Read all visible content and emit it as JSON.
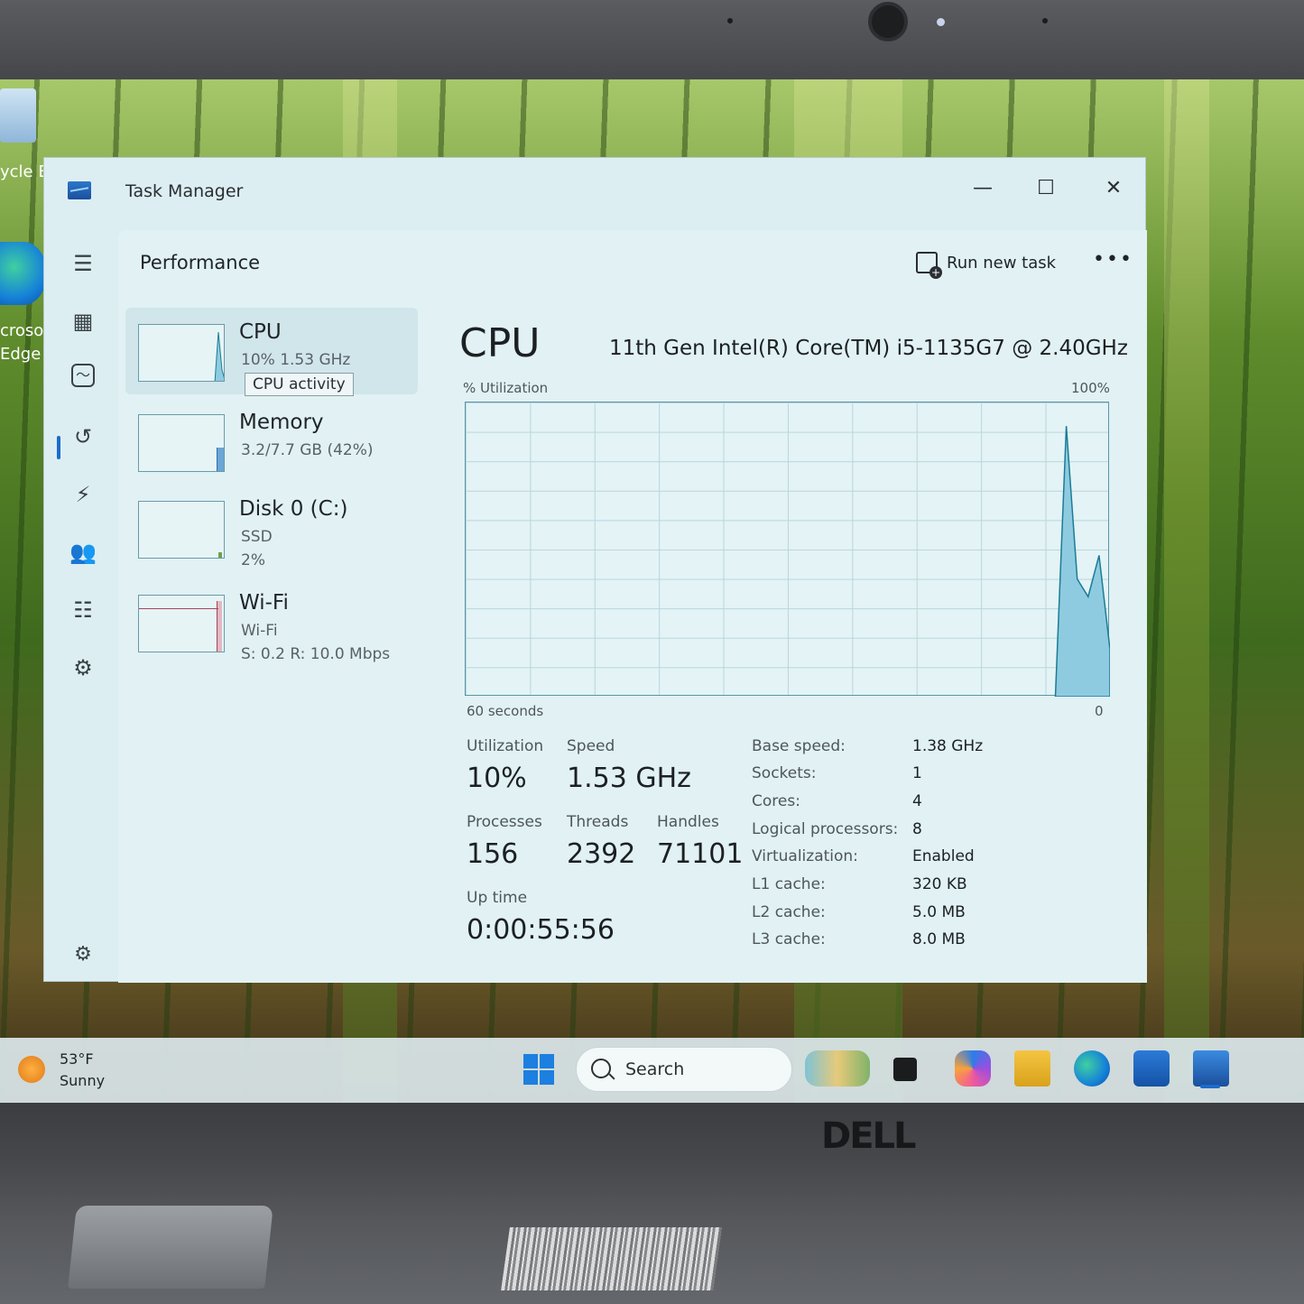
{
  "device": {
    "brand": "DELL"
  },
  "desktop": {
    "icons": [
      {
        "label_line1": "ycle B",
        "label_line2": ""
      },
      {
        "label_line1": "crosof",
        "label_line2": "Edge"
      }
    ]
  },
  "window": {
    "title": "Task Manager",
    "minimize": "—",
    "maximize": "☐",
    "close": "✕"
  },
  "header": {
    "page_title": "Performance",
    "run_new_task": "Run new task",
    "more": "•••"
  },
  "nav": {
    "icons": [
      "hamburger-icon",
      "processes-icon",
      "performance-icon",
      "app-history-icon",
      "startup-apps-icon",
      "users-icon",
      "details-icon",
      "services-icon",
      "settings-icon"
    ]
  },
  "resources": [
    {
      "name": "CPU",
      "sub1": "10%  1.53 GHz",
      "sub2": "",
      "tooltip": "CPU activity"
    },
    {
      "name": "Memory",
      "sub1": "3.2/7.7 GB (42%)",
      "sub2": ""
    },
    {
      "name": "Disk 0 (C:)",
      "sub1": "SSD",
      "sub2": "2%"
    },
    {
      "name": "Wi-Fi",
      "sub1": "Wi-Fi",
      "sub2": "S: 0.2  R: 10.0 Mbps"
    }
  ],
  "cpu": {
    "heading": "CPU",
    "model": "11th Gen Intel(R) Core(TM) i5-1135G7 @ 2.40GHz",
    "graph_ylabel": "% Utilization",
    "graph_ymax": "100%",
    "graph_xlabel": "60 seconds",
    "graph_xmin": "0",
    "stats": {
      "utilization_label": "Utilization",
      "utilization": "10%",
      "speed_label": "Speed",
      "speed": "1.53 GHz",
      "processes_label": "Processes",
      "processes": "156",
      "threads_label": "Threads",
      "threads": "2392",
      "handles_label": "Handles",
      "handles": "71101",
      "uptime_label": "Up time",
      "uptime": "0:00:55:56"
    },
    "specs": [
      {
        "label": "Base speed:",
        "value": "1.38 GHz"
      },
      {
        "label": "Sockets:",
        "value": "1"
      },
      {
        "label": "Cores:",
        "value": "4"
      },
      {
        "label": "Logical processors:",
        "value": "8"
      },
      {
        "label": "Virtualization:",
        "value": "Enabled"
      },
      {
        "label": "L1 cache:",
        "value": "320 KB"
      },
      {
        "label": "L2 cache:",
        "value": "5.0 MB"
      },
      {
        "label": "L3 cache:",
        "value": "8.0 MB"
      }
    ],
    "series_color": "#8fcbe0",
    "series_stroke": "#1a7d95",
    "history": [
      0,
      0,
      0,
      0,
      0,
      0,
      0,
      0,
      0,
      0,
      0,
      0,
      0,
      0,
      0,
      0,
      0,
      0,
      0,
      0,
      0,
      0,
      0,
      0,
      0,
      0,
      0,
      0,
      0,
      0,
      0,
      0,
      0,
      0,
      0,
      0,
      0,
      0,
      0,
      0,
      0,
      0,
      0,
      0,
      0,
      0,
      0,
      0,
      0,
      0,
      0,
      0,
      0,
      0,
      0,
      92,
      40,
      34,
      48,
      16
    ]
  },
  "taskbar": {
    "weather_temp": "53°F",
    "weather_cond": "Sunny",
    "search_placeholder": "Search",
    "apps": [
      "widgets-icon",
      "task-view-icon",
      "copilot-icon",
      "file-explorer-icon",
      "edge-icon",
      "store-icon",
      "task-manager-icon"
    ]
  }
}
